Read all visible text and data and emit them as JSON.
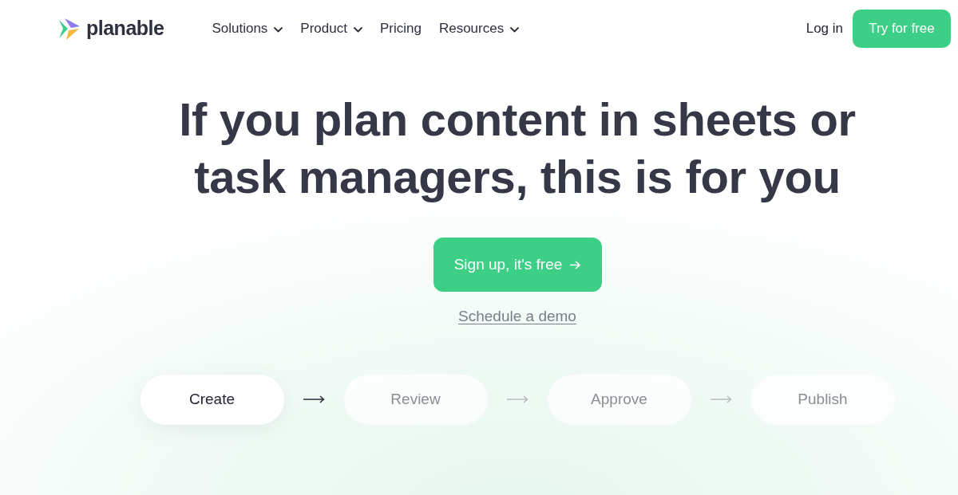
{
  "nav": {
    "brand": "planable",
    "links": [
      {
        "label": "Solutions",
        "dropdown": true
      },
      {
        "label": "Product",
        "dropdown": true
      },
      {
        "label": "Pricing",
        "dropdown": false
      },
      {
        "label": "Resources",
        "dropdown": true
      }
    ],
    "login": "Log in",
    "cta": "Try for free"
  },
  "hero": {
    "title_lines": [
      "If you plan content in sheets or",
      "task managers, this is for you"
    ],
    "primary_button": "Sign up, it's free",
    "secondary_link": "Schedule a demo"
  },
  "steps": [
    {
      "label": "Create",
      "selected": true
    },
    {
      "label": "Review",
      "selected": false
    },
    {
      "label": "Approve",
      "selected": false
    },
    {
      "label": "Publish",
      "selected": false
    }
  ]
}
